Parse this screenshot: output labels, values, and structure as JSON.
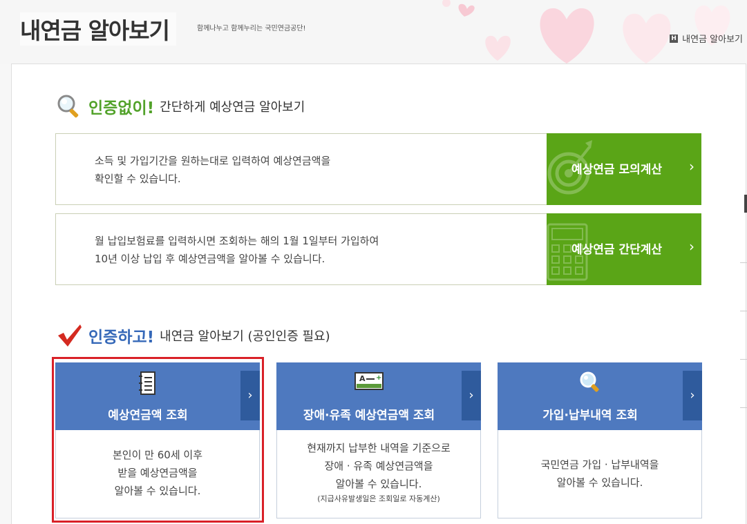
{
  "header": {
    "title": "내연금 알아보기",
    "subtitle": "함께나누고 함께누리는 국민연금공단!",
    "breadcrumb": {
      "icon": "home-icon",
      "home_glyph": "H",
      "label": "내연금 알아보기"
    }
  },
  "section_no_auth": {
    "icon": "magnifier-icon",
    "strong": "인증없이!",
    "rest": "간단하게 예상연금 알아보기",
    "color": "#52a22a",
    "rows": [
      {
        "description": "소득 및 가입기간을 원하는대로 입력하여 예상연금액을\n확인할 수 있습니다.",
        "button_label": "예상연금 모의계산",
        "button_icon": "target-icon"
      },
      {
        "description": "월 납입보험료를 입력하시면 조회하는 해의 1월 1일부터 가입하여\n10년 이상 납입 후 예상연금액을 알아볼 수 있습니다.",
        "button_label": "예상연금 간단계산",
        "button_icon": "calculator-icon"
      }
    ]
  },
  "section_auth": {
    "icon": "checkmark-icon",
    "strong": "인증하고!",
    "rest": "내연금 알아보기 (공인인증 필요)",
    "color": "#3568b8",
    "cards": [
      {
        "title": "예상연금액 조회",
        "icon": "document-icon",
        "lines": [
          "본인이 만 60세 이후",
          "받을 예상연금액을",
          "알아볼 수 있습니다."
        ],
        "note": ""
      },
      {
        "title": "장애·유족 예상연금액 조회",
        "icon": "id-card-icon",
        "lines": [
          "현재까지 납부한 내역을 기준으로",
          "장애 · 유족 예상연금액을",
          "알아볼 수 있습니다."
        ],
        "note": "(지급사유발생일은 조회일로 자동계산)"
      },
      {
        "title": "가입·납부내역 조회",
        "icon": "search-icon",
        "lines": [
          "국민연금 가입 · 납부내역을",
          "알아볼 수 있습니다."
        ],
        "note": ""
      }
    ]
  },
  "colors": {
    "green_button": "#5aa517",
    "card_blue": "#4e79bf",
    "card_arrow": "#2f5b9d",
    "highlight": "#d92027"
  }
}
